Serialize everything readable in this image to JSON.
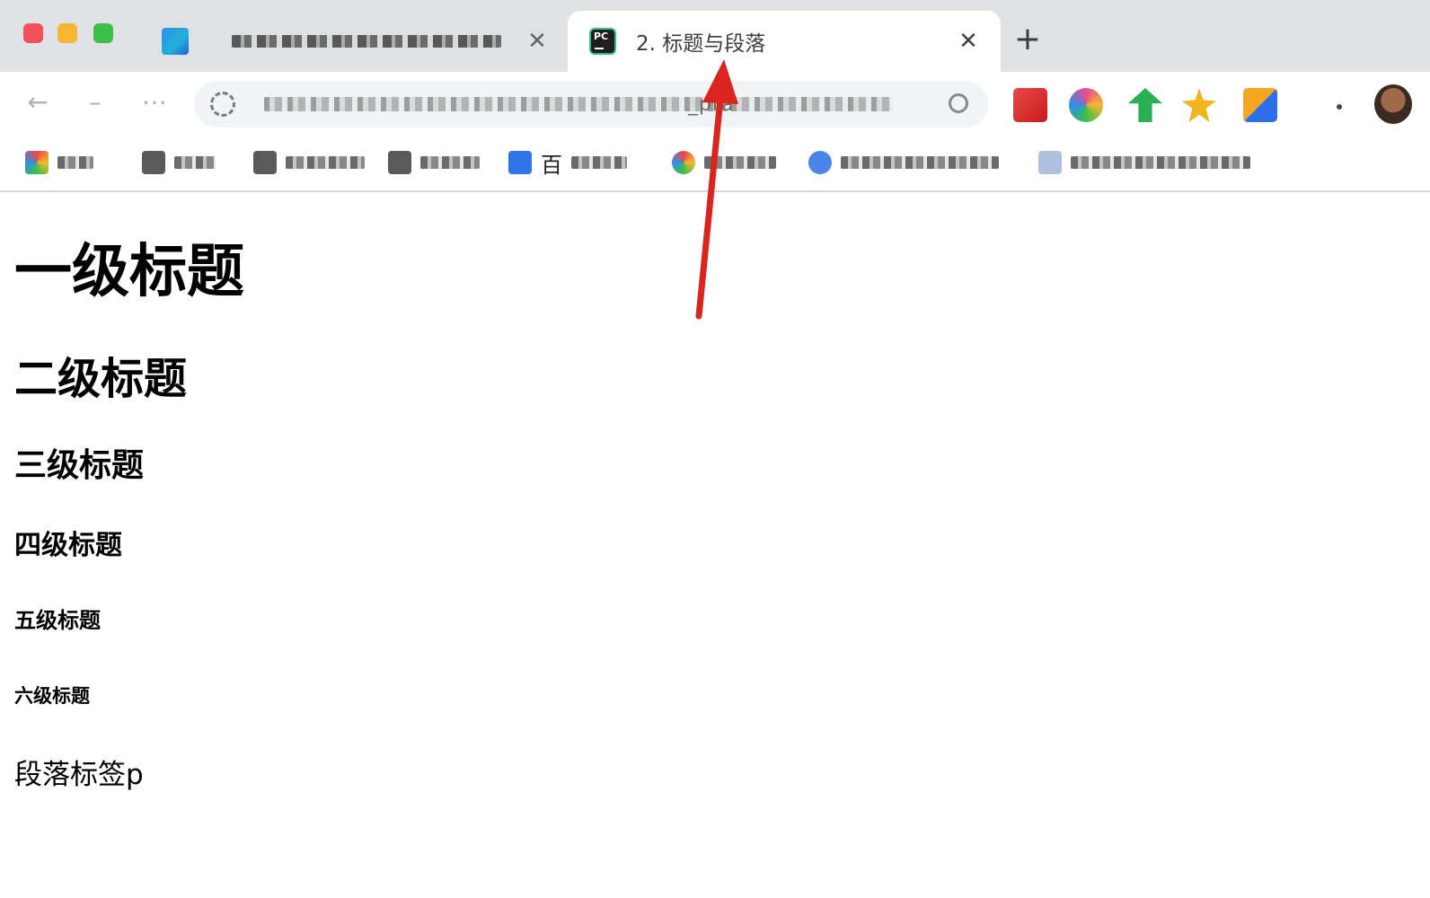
{
  "window": {
    "traffic_lights": [
      "close",
      "minimize",
      "maximize"
    ]
  },
  "tabs": [
    {
      "title_obscured": true,
      "icon": "app-icon-blue",
      "active": false
    },
    {
      "title": "2. 标题与段落",
      "icon": "pycharm-icon",
      "icon_text": "PC",
      "active": true
    }
  ],
  "toolbar": {
    "back": "←",
    "forward": "→",
    "reload": "⟳",
    "url_visible": "_pra",
    "url_obscured": true
  },
  "bookmarks": [
    {
      "label_obscured": true,
      "icon": "apps-icon"
    },
    {
      "label_obscured": true,
      "icon": "folder-icon"
    },
    {
      "label_obscured": true,
      "icon": "folder-icon"
    },
    {
      "label_obscured": true,
      "icon": "folder-icon"
    },
    {
      "label": "百",
      "label_obscured_tail": true,
      "icon": "baidu-icon"
    },
    {
      "label_obscured": true,
      "icon": "google-icon"
    },
    {
      "label_obscured": true,
      "icon": "cloud-icon"
    },
    {
      "label_obscured": true,
      "icon": "doc-icon"
    }
  ],
  "content": {
    "h1": "一级标题",
    "h2": "二级标题",
    "h3": "三级标题",
    "h4": "四级标题",
    "h5": "五级标题",
    "h6": "六级标题",
    "paragraph": "段落标签p"
  },
  "colors": {
    "tabstrip_bg": "#dfe1e5",
    "annotation_arrow": "#d9251d",
    "text": "#000000"
  }
}
